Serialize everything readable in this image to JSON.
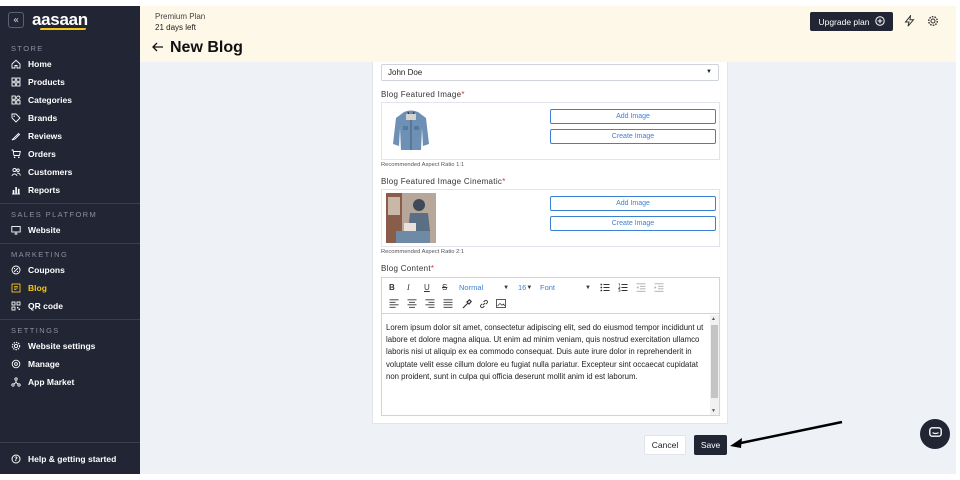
{
  "app": {
    "logo": "aasaan",
    "collapse_glyph": "«"
  },
  "sidebar": {
    "store_title": "STORE",
    "store_items": [
      {
        "label": "Home",
        "icon": "home-icon"
      },
      {
        "label": "Products",
        "icon": "products-icon"
      },
      {
        "label": "Categories",
        "icon": "categories-icon"
      },
      {
        "label": "Brands",
        "icon": "tag-icon"
      },
      {
        "label": "Reviews",
        "icon": "reviews-icon"
      },
      {
        "label": "Orders",
        "icon": "cart-icon"
      },
      {
        "label": "Customers",
        "icon": "customers-icon"
      },
      {
        "label": "Reports",
        "icon": "reports-icon"
      }
    ],
    "sales_title": "SALES PLATFORM",
    "sales_items": [
      {
        "label": "Website",
        "icon": "monitor-icon"
      }
    ],
    "marketing_title": "MARKETING",
    "marketing_items": [
      {
        "label": "Coupons",
        "icon": "coupon-icon"
      },
      {
        "label": "Blog",
        "icon": "blog-icon",
        "active": true
      },
      {
        "label": "QR code",
        "icon": "qr-icon"
      }
    ],
    "settings_title": "SETTINGS",
    "settings_items": [
      {
        "label": "Website settings",
        "icon": "gear-icon"
      },
      {
        "label": "Manage",
        "icon": "manage-icon"
      },
      {
        "label": "App Market",
        "icon": "app-market-icon"
      }
    ],
    "help_label": "Help & getting started"
  },
  "topbar": {
    "plan_name": "Premium Plan",
    "days_left": "21 days left",
    "upgrade_label": "Upgrade plan"
  },
  "page": {
    "title": "New Blog"
  },
  "form": {
    "author_value": "John Doe",
    "featured_label": "Blog Featured Image",
    "featured_hint": "Recommended Aspect Ratio 1:1",
    "cinematic_label": "Blog Featured Image Cinematic",
    "cinematic_hint": "Recommended Aspect Ratio 2:1",
    "add_image_label": "Add Image",
    "create_image_label": "Create Image",
    "content_label": "Blog Content",
    "required_mark": "*",
    "toolbar": {
      "format": "Normal",
      "size": "16",
      "font": "Font"
    },
    "content_text": "Lorem ipsum dolor sit amet, consectetur adipiscing elit, sed do eiusmod tempor incididunt ut labore et dolore magna aliqua. Ut enim ad minim veniam, quis nostrud exercitation ullamco laboris nisi ut aliquip ex ea commodo consequat. Duis aute irure dolor in reprehenderit in voluptate velit esse cillum dolore eu fugiat nulla pariatur. Excepteur sint occaecat cupidatat non proident, sunt in culpa qui officia deserunt mollit anim id est laborum."
  },
  "actions": {
    "cancel_label": "Cancel",
    "save_label": "Save"
  },
  "colors": {
    "sidebar_bg": "#212534",
    "accent": "#f5c518",
    "link_blue": "#3b82d6",
    "topbar_bg": "#fdf8e8"
  }
}
